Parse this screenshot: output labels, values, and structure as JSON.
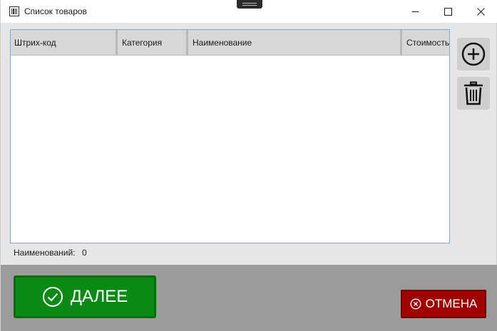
{
  "window": {
    "title": "Список товаров",
    "icon": "barcode-app-icon"
  },
  "grid": {
    "columns": [
      "Штрих-код",
      "Категория",
      "Наименование",
      "Стоимость"
    ],
    "rows": []
  },
  "side_actions": {
    "add_icon": "plus-circle-icon",
    "delete_icon": "trash-icon"
  },
  "summary": {
    "count_label": "Наименований:",
    "count_value": "0"
  },
  "footer": {
    "next_label": "ДАЛЕЕ",
    "cancel_label": "ОТМЕНА"
  },
  "colors": {
    "next_button": "#0a8a14",
    "cancel_button": "#a00000",
    "bottom_bar": "#9b9b9b",
    "grid_header": "#d7d7d7"
  }
}
